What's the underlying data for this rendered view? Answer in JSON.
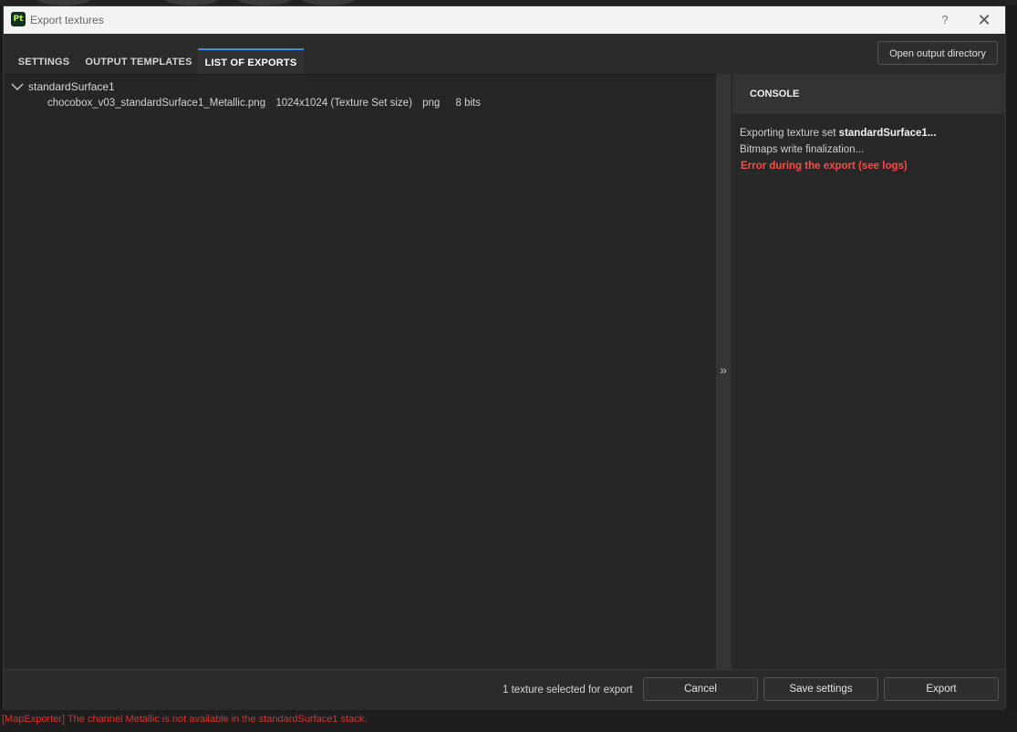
{
  "window": {
    "app_icon_text": "Pt",
    "title": "Export textures",
    "help_glyph": "?",
    "close_glyph": "✕"
  },
  "tabs": [
    {
      "label": "SETTINGS"
    },
    {
      "label": "OUTPUT TEMPLATES"
    },
    {
      "label": "LIST OF EXPORTS",
      "active": true
    }
  ],
  "toolbar": {
    "open_output_directory": "Open output directory"
  },
  "export_list": {
    "group": {
      "name": "standardSurface1",
      "items": [
        {
          "filename": "chocobox_v03_standardSurface1_Metallic.png",
          "size": "1024x1024 (Texture Set size)",
          "format": "png",
          "bit_depth": "8 bits"
        }
      ]
    }
  },
  "splitter": {
    "glyph": "»"
  },
  "console": {
    "title": "CONSOLE",
    "logs": {
      "line1_prefix": "Exporting texture set ",
      "line1_name": "standardSurface1...",
      "line2": "Bitmaps write finalization...",
      "line3_error": "Error during the export (see logs)"
    }
  },
  "footer": {
    "status": "1 texture selected for export",
    "cancel": "Cancel",
    "save_settings": "Save settings",
    "export": "Export"
  },
  "statusbar": {
    "message": "[MapExporter] The channel Metallic is not available in the standardSurface1 stack."
  },
  "colors": {
    "accent_tab": "#3f8ae2",
    "error": "#ff4a3d",
    "statusbar_error": "#e0302a"
  }
}
